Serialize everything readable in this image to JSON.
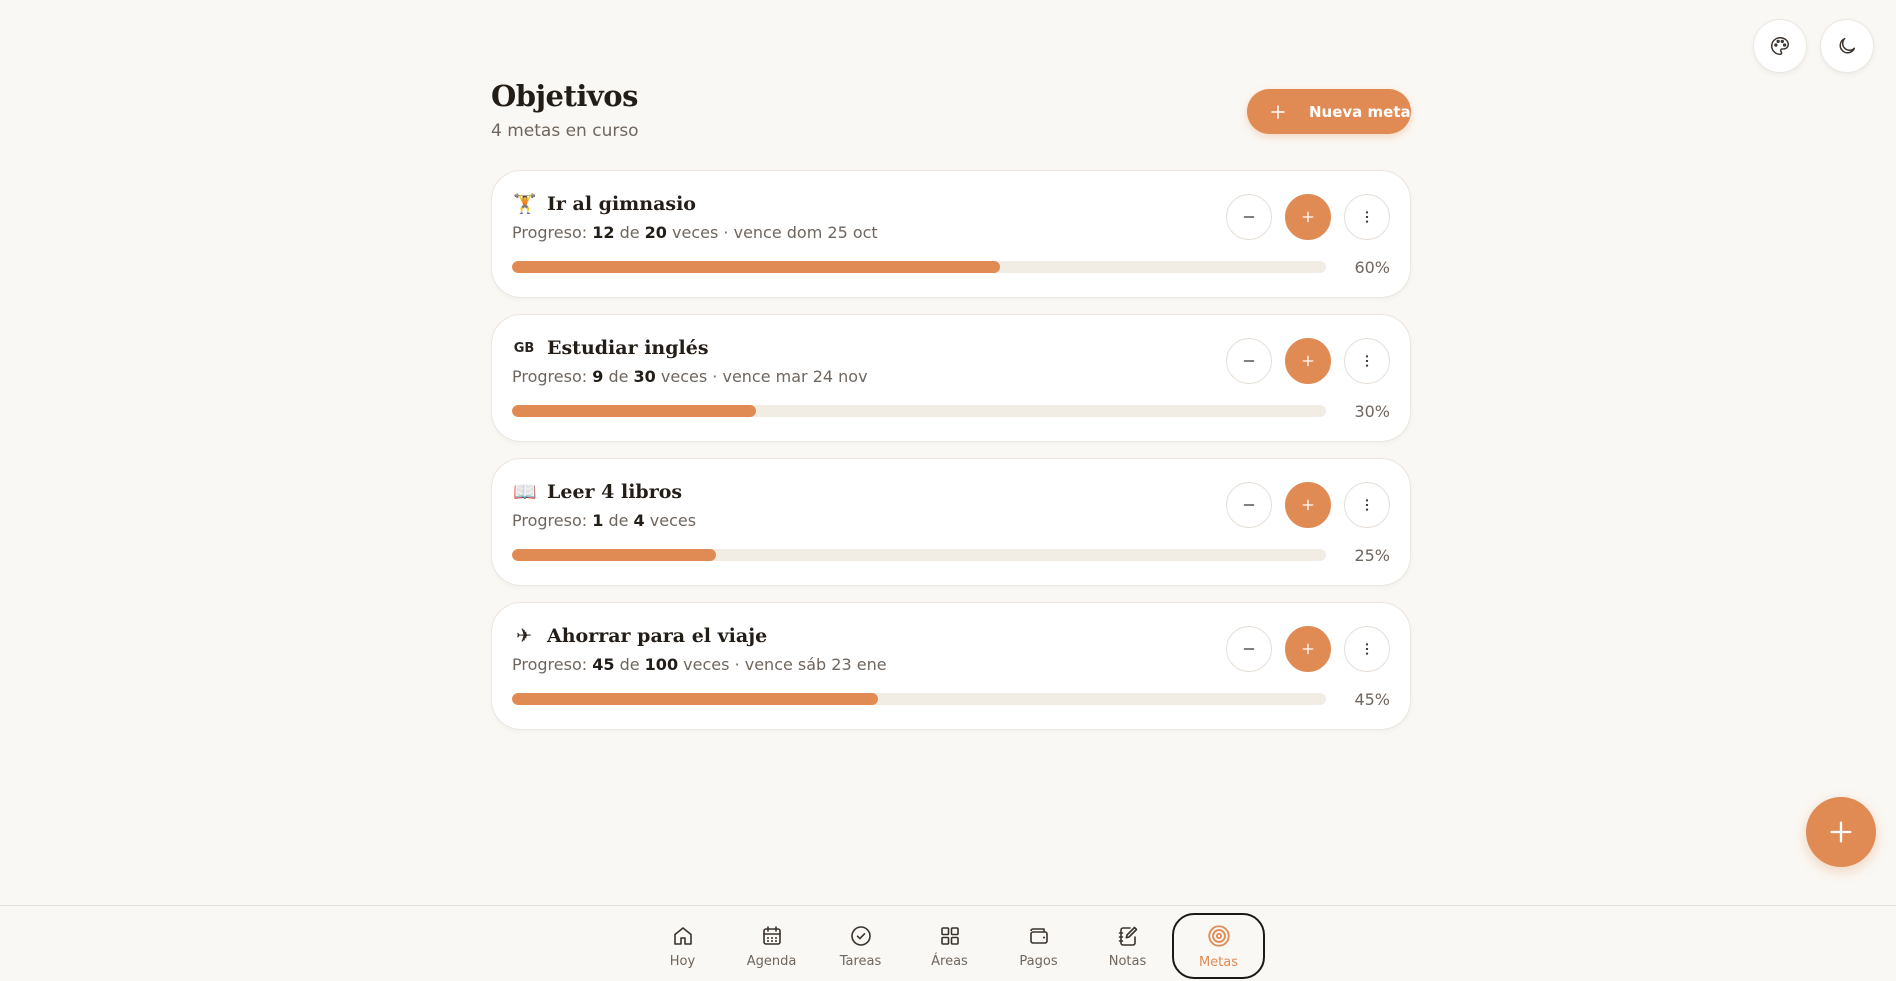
{
  "header": {
    "title": "Objetivos",
    "subtitle": "4 metas en curso",
    "new_button_label": "Nueva meta"
  },
  "top_actions": [
    {
      "name": "palette-icon"
    },
    {
      "name": "moon-icon"
    }
  ],
  "goals": [
    {
      "emoji": "🏋",
      "emoji_is_text": false,
      "name": "Ir al gimnasio",
      "progress_prefix": "Progreso:",
      "current": "12",
      "of": "de",
      "target": "20",
      "unit": "veces",
      "due": "· vence dom 25 oct",
      "percent_label": "60%",
      "progress": 0.6
    },
    {
      "emoji": "GB",
      "emoji_is_text": true,
      "name": "Estudiar inglés",
      "progress_prefix": "Progreso:",
      "current": "9",
      "of": "de",
      "target": "30",
      "unit": "veces",
      "due": "· vence mar 24 nov",
      "percent_label": "30%",
      "progress": 0.3
    },
    {
      "emoji": "📖",
      "emoji_is_text": false,
      "name": "Leer 4 libros",
      "progress_prefix": "Progreso:",
      "current": "1",
      "of": "de",
      "target": "4",
      "unit": "veces",
      "due": "",
      "percent_label": "25%",
      "progress": 0.25
    },
    {
      "emoji": "✈",
      "emoji_is_text": false,
      "name": "Ahorrar para el viaje",
      "progress_prefix": "Progreso:",
      "current": "45",
      "of": "de",
      "target": "100",
      "unit": "veces",
      "due": "· vence sáb 23 ene",
      "percent_label": "45%",
      "progress": 0.45
    }
  ],
  "nav": [
    {
      "label": "Hoy",
      "icon": "home-icon",
      "active": false
    },
    {
      "label": "Agenda",
      "icon": "calendar-icon",
      "active": false
    },
    {
      "label": "Tareas",
      "icon": "check-circle-icon",
      "active": false
    },
    {
      "label": "Áreas",
      "icon": "grid-icon",
      "active": false
    },
    {
      "label": "Pagos",
      "icon": "wallet-icon",
      "active": false
    },
    {
      "label": "Notas",
      "icon": "notebook-icon",
      "active": false
    },
    {
      "label": "Metas",
      "icon": "target-icon",
      "active": true
    }
  ],
  "colors": {
    "accent": "#e08b54",
    "background": "#faf8f4",
    "track": "#f1ece4"
  }
}
